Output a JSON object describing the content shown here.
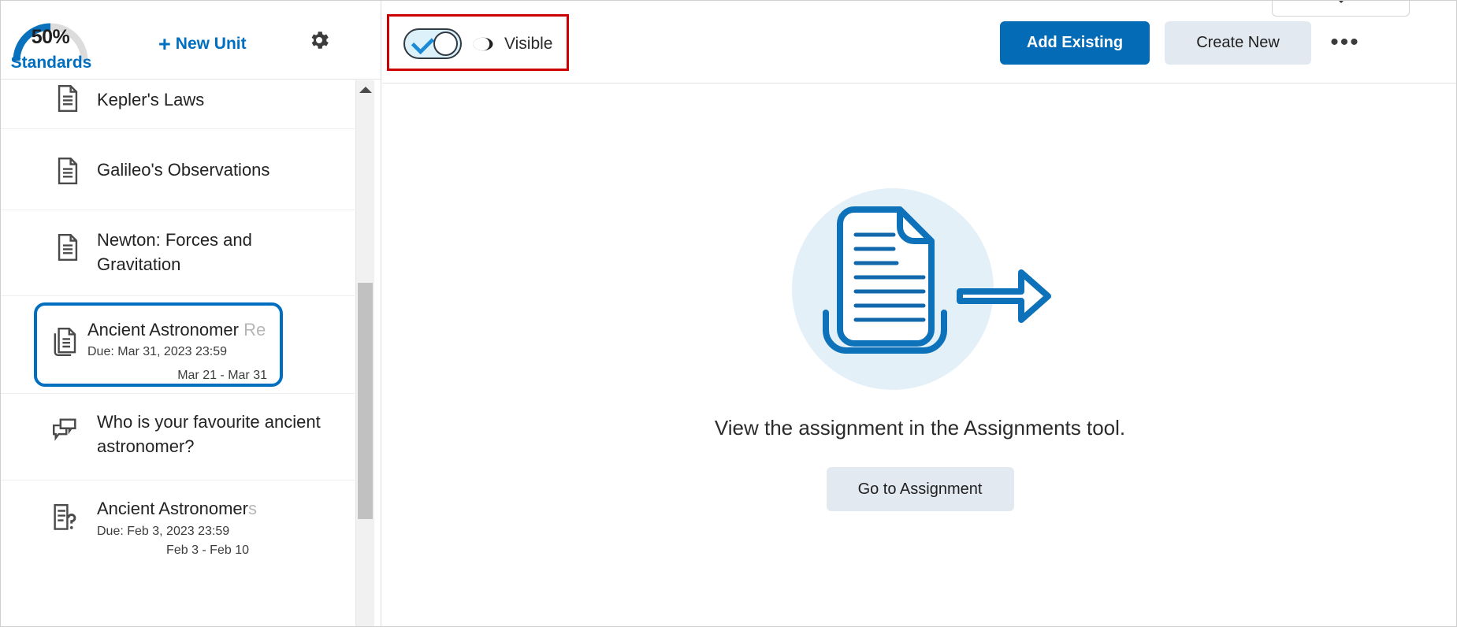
{
  "sidebar": {
    "header": {
      "gauge": {
        "percent_label": "50%",
        "percent_value": 50,
        "caption": "Standards",
        "arc_color": "#0a72bd",
        "track_color": "#dcdcdc"
      },
      "new_unit_label": "New Unit",
      "new_unit_plus": "+",
      "settings_icon": "gear-icon"
    },
    "scrollbar": {
      "up_arrow": "caret-up-icon"
    },
    "items": [
      {
        "icon": "content-file-icon",
        "title": "Kepler's Laws",
        "title_faded": "",
        "due": "",
        "range": "",
        "selected": false
      },
      {
        "icon": "content-file-icon",
        "title": "Galileo's Observations",
        "title_faded": "",
        "due": "",
        "range": "",
        "selected": false
      },
      {
        "icon": "content-file-icon",
        "title": "Newton: Forces and Gravitation",
        "title_faded": "",
        "due": "",
        "range": "",
        "selected": false
      },
      {
        "icon": "assignment-icon",
        "title": "Ancient Astronomer ",
        "title_faded": "Re",
        "due": "Due: Mar 31, 2023 23:59",
        "range": "Mar 21 - Mar 31",
        "selected": true
      },
      {
        "icon": "discussion-icon",
        "title": "Who is your favourite ancient astronomer?",
        "title_faded": "",
        "due": "",
        "range": "",
        "selected": false
      },
      {
        "icon": "quiz-icon",
        "title": "Ancient Astronomer",
        "title_faded": "s",
        "due": "Due: Feb 3, 2023 23:59",
        "range": "Feb 3 - Feb 10",
        "selected": false
      }
    ]
  },
  "toolbar": {
    "visibility": {
      "switch_state": "on",
      "check_icon": "checkmark-icon",
      "eye_icon": "eye-icon",
      "label": "Visible",
      "highlight_color": "#cc0000"
    },
    "add_existing_label": "Add Existing",
    "create_new_label": "Create New",
    "more_actions_label": "•••",
    "dropdown_chevron": "chevron-down-icon",
    "accent_color": "#046cb6"
  },
  "main": {
    "illustration": "document-export-illustration",
    "message": "View the assignment in the Assignments tool.",
    "action_label": "Go to Assignment"
  }
}
